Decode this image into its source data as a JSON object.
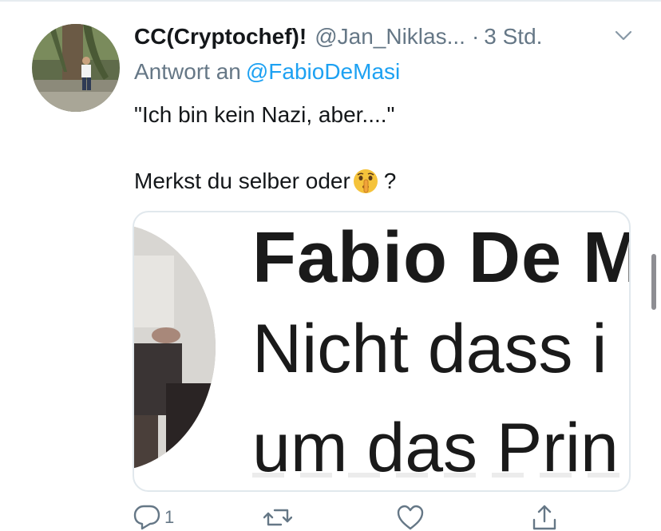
{
  "tweet": {
    "display_name": "CC(Cryptochef)!",
    "handle": "@Jan_Niklas...",
    "separator": "·",
    "timestamp": "3 Std.",
    "reply_prefix": "Antwort an",
    "reply_mention": "@FabioDeMasi",
    "text_line1": "\"Ich bin kein Nazi, aber....\"",
    "text_line2": "Merkst du selber oder",
    "text_line2_end": "?",
    "emoji": "shushing-face-emoji"
  },
  "media": {
    "title": "Fabio De M",
    "line1": "Nicht dass i",
    "line2": "um das Prin"
  },
  "actions": {
    "reply_count": "1",
    "icons": [
      "reply-icon",
      "retweet-icon",
      "like-icon",
      "share-icon"
    ]
  },
  "colors": {
    "link": "#1da1f2",
    "secondary_text": "#657786",
    "primary_text": "#14171a",
    "card_border": "#e1e8ed"
  }
}
